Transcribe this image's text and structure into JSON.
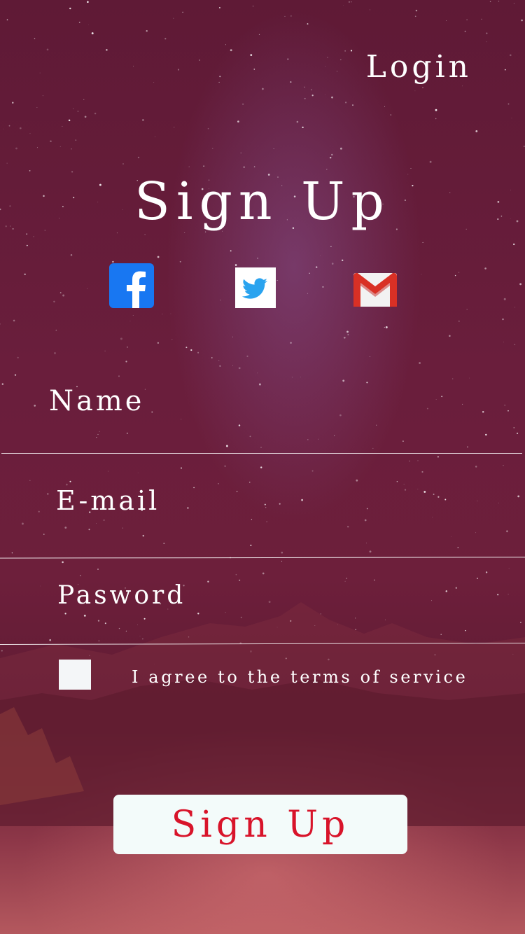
{
  "header": {
    "login_label": "Login"
  },
  "main": {
    "title": "Sign Up",
    "social": [
      {
        "name": "facebook",
        "icon": "facebook-icon"
      },
      {
        "name": "twitter",
        "icon": "twitter-icon"
      },
      {
        "name": "gmail",
        "icon": "gmail-icon"
      }
    ],
    "fields": {
      "name_label": "Name",
      "email_label": "E-mail",
      "password_label": "Pasword"
    },
    "terms": {
      "checked": false,
      "label": "I agree to the terms of service"
    },
    "signup_button_label": "Sign Up"
  },
  "colors": {
    "background": "#6b1d3a",
    "button_bg": "#f3fbfa",
    "button_text": "#d8142a",
    "text": "#ffffff"
  }
}
